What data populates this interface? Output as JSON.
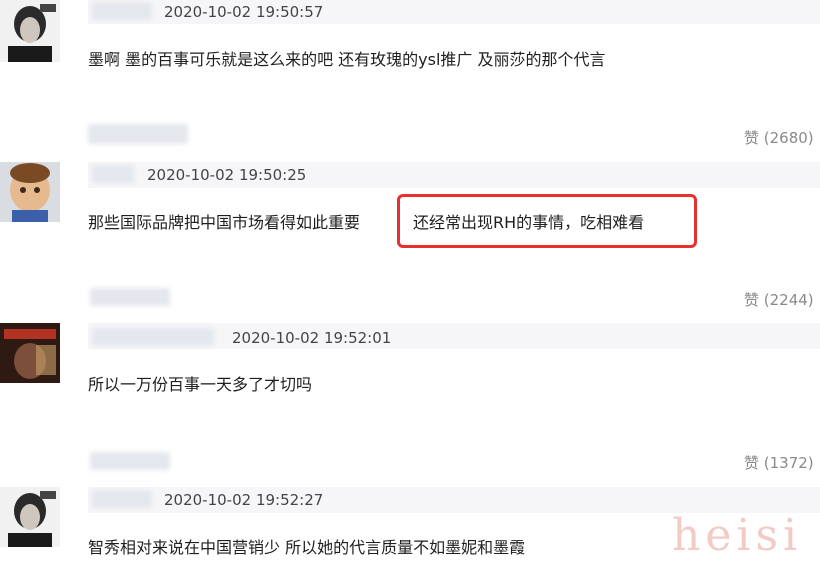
{
  "comments": [
    {
      "time": "2020-10-02 19:50:57",
      "text": "墨啊 墨的百事可乐就是这么来的吧 还有玫瑰的ysl推广 及丽莎的那个代言",
      "likes": "赞 (2680)"
    },
    {
      "time": "2020-10-02 19:50:25",
      "text_a": "那些国际品牌把中国市场看得如此重要",
      "text_b": "还经常出现RH的事情，吃相难看",
      "likes": "赞 (2244)"
    },
    {
      "time": "2020-10-02 19:52:01",
      "text": "所以一万份百事一天多了才切吗",
      "likes": "赞 (1372)"
    },
    {
      "time": "2020-10-02 19:52:27",
      "text": "智秀相对来说在中国营销少 所以她的代言质量不如墨妮和墨霞"
    }
  ],
  "watermark": "heisi",
  "colors": {
    "highlight": "#e8302e",
    "meta_bar": "#f6f6f8"
  }
}
